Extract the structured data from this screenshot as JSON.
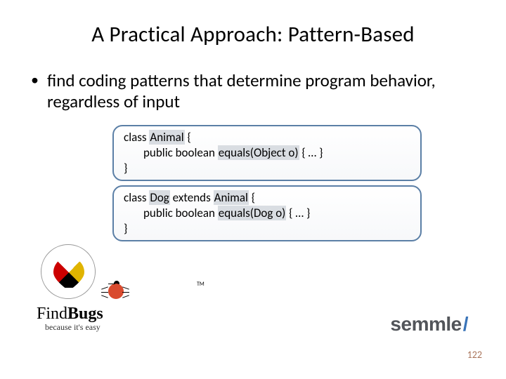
{
  "title": "A Practical Approach: Pattern-Based",
  "bullet": "find coding patterns that determine program behavior, regardless of input",
  "code1": {
    "l1a": "class ",
    "l1b": "Animal",
    "l1c": " {",
    "l2a": "public boolean ",
    "l2b": "equals(Object o)",
    "l2c": " { … }",
    "l3": "}"
  },
  "code2": {
    "l1a": "class ",
    "l1b": "Dog",
    "l1c": " extends ",
    "l1d": "Animal",
    "l1e": " {",
    "l2a": "public boolean ",
    "l2b": "equals(Dog o)",
    "l2c": " { … }",
    "l3": "}"
  },
  "logos": {
    "findbugs": "FindBugs",
    "findbugs_tag": "because it's easy",
    "tm": "TM",
    "semmle": "semmle",
    "slash": "/"
  },
  "pagenum": "122"
}
